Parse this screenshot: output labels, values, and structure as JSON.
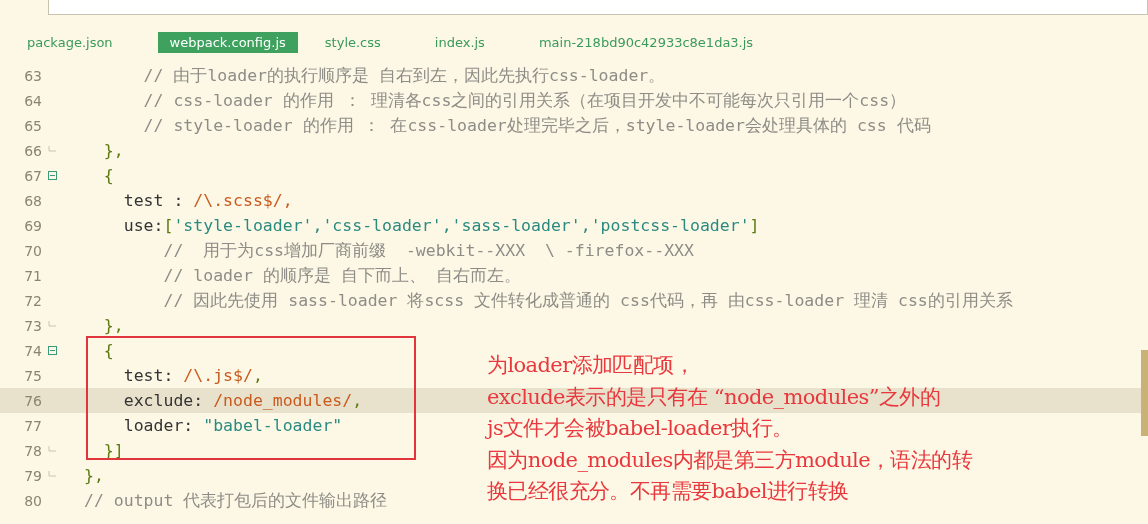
{
  "tabs": [
    {
      "label": "package.json",
      "selected": false
    },
    {
      "label": "webpack.config.js",
      "selected": true
    },
    {
      "label": "style.css",
      "selected": false
    },
    {
      "label": "index.js",
      "selected": false
    },
    {
      "label": "main-218bd90c42933c8e1da3.js",
      "selected": false
    }
  ],
  "lines": [
    {
      "number": "63",
      "fold_start": false,
      "fold_end": false,
      "current": false,
      "tokens": [
        {
          "kind": "comment",
          "text": "      // 由于loader的执行顺序是 自右到左，因此先执行css-loader。"
        }
      ]
    },
    {
      "number": "64",
      "fold_start": false,
      "fold_end": false,
      "current": false,
      "tokens": [
        {
          "kind": "comment",
          "text": "      // css-loader 的作用 ： 理清各css之间的引用关系（在项目开发中不可能每次只引用一个css）"
        }
      ]
    },
    {
      "number": "65",
      "fold_start": false,
      "fold_end": false,
      "current": false,
      "tokens": [
        {
          "kind": "comment",
          "text": "      // style-loader 的作用 ： 在css-loader处理完毕之后，style-loader会处理具体的 css 代码"
        }
      ]
    },
    {
      "number": "66",
      "fold_start": false,
      "fold_end": true,
      "current": false,
      "tokens": [
        {
          "kind": "punct",
          "text": "  },"
        }
      ]
    },
    {
      "number": "67",
      "fold_start": true,
      "fold_end": false,
      "current": false,
      "tokens": [
        {
          "kind": "punct",
          "text": "  {"
        }
      ]
    },
    {
      "number": "68",
      "fold_start": false,
      "fold_end": false,
      "current": false,
      "tokens": [
        {
          "kind": "plain",
          "text": "    test : "
        },
        {
          "kind": "regex",
          "text": "/\\.scss$/,"
        }
      ]
    },
    {
      "number": "69",
      "fold_start": false,
      "fold_end": false,
      "current": false,
      "tokens": [
        {
          "kind": "plain",
          "text": "    use:"
        },
        {
          "kind": "punct",
          "text": "["
        },
        {
          "kind": "string",
          "text": "'style-loader','css-loader','sass-loader','postcss-loader'"
        },
        {
          "kind": "punct",
          "text": "]"
        }
      ]
    },
    {
      "number": "70",
      "fold_start": false,
      "fold_end": false,
      "current": false,
      "tokens": [
        {
          "kind": "comment",
          "text": "        //  用于为css增加厂商前缀  -webkit--XXX  \\ -firefox--XXX"
        }
      ]
    },
    {
      "number": "71",
      "fold_start": false,
      "fold_end": false,
      "current": false,
      "tokens": [
        {
          "kind": "comment",
          "text": "        // loader 的顺序是 自下而上、 自右而左。"
        }
      ]
    },
    {
      "number": "72",
      "fold_start": false,
      "fold_end": false,
      "current": false,
      "tokens": [
        {
          "kind": "comment",
          "text": "        // 因此先使用 sass-loader 将scss 文件转化成普通的 css代码，再 由css-loader 理清 css的引用关系"
        }
      ]
    },
    {
      "number": "73",
      "fold_start": false,
      "fold_end": true,
      "current": false,
      "tokens": [
        {
          "kind": "punct",
          "text": "  },"
        }
      ]
    },
    {
      "number": "74",
      "fold_start": true,
      "fold_end": false,
      "current": false,
      "tokens": [
        {
          "kind": "punct",
          "text": "  {"
        }
      ]
    },
    {
      "number": "75",
      "fold_start": false,
      "fold_end": false,
      "current": false,
      "tokens": [
        {
          "kind": "plain",
          "text": "    test: "
        },
        {
          "kind": "regex",
          "text": "/\\.js$/"
        },
        {
          "kind": "punct",
          "text": ","
        }
      ]
    },
    {
      "number": "76",
      "fold_start": false,
      "fold_end": false,
      "current": true,
      "tokens": [
        {
          "kind": "plain",
          "text": "    exclude: "
        },
        {
          "kind": "regex",
          "text": "/node_modules/"
        },
        {
          "kind": "punct",
          "text": ","
        }
      ]
    },
    {
      "number": "77",
      "fold_start": false,
      "fold_end": false,
      "current": false,
      "tokens": [
        {
          "kind": "plain",
          "text": "    loader: "
        },
        {
          "kind": "string",
          "text": "\"babel-loader\""
        }
      ]
    },
    {
      "number": "78",
      "fold_start": false,
      "fold_end": true,
      "current": false,
      "tokens": [
        {
          "kind": "punct",
          "text": "  }]"
        }
      ]
    },
    {
      "number": "79",
      "fold_start": false,
      "fold_end": true,
      "current": false,
      "tokens": [
        {
          "kind": "punct",
          "text": "},"
        }
      ]
    },
    {
      "number": "80",
      "fold_start": false,
      "fold_end": false,
      "current": false,
      "tokens": [
        {
          "kind": "comment",
          "text": "// output 代表打包后的文件输出路径"
        }
      ]
    }
  ],
  "annotation": {
    "lines": [
      "为loader添加匹配项，",
      "exclude表示的是只有在 “node_modules”之外的",
      "js文件才会被babel-loader执行。",
      "因为node_modules内都是第三方module，语法的转",
      "换已经很充分。不再需要babel进行转换"
    ]
  }
}
